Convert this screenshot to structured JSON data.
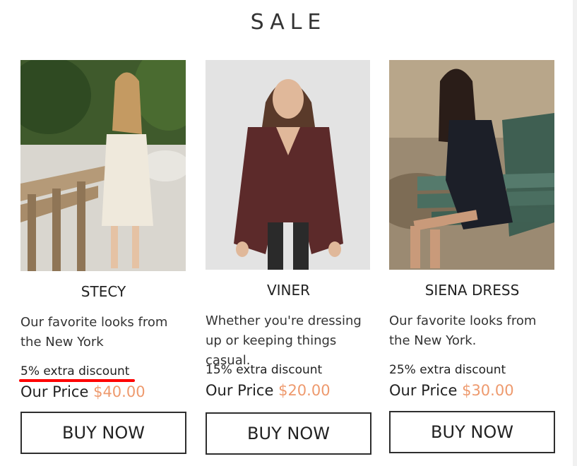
{
  "page": {
    "title": "SALE"
  },
  "products": [
    {
      "name": "STECY",
      "description": "Our favorite looks from the New York",
      "discount": "5% extra discount",
      "price_label": "Our Price",
      "price": "$40.00",
      "button": "BUY NOW"
    },
    {
      "name": "VINER",
      "description": "Whether you're dressing up or keeping things casual.",
      "discount": "15% extra discount",
      "price_label": "Our Price",
      "price": "$20.00",
      "button": "BUY NOW"
    },
    {
      "name": "SIENA DRESS",
      "description": "Our favorite looks from the New York.",
      "discount": "25% extra discount",
      "price_label": "Our Price",
      "price": "$30.00",
      "button": "BUY NOW"
    }
  ],
  "colors": {
    "price": "#ee9a6e",
    "highlight_underline": "#ff0000",
    "button_border": "#2e2e2e"
  }
}
